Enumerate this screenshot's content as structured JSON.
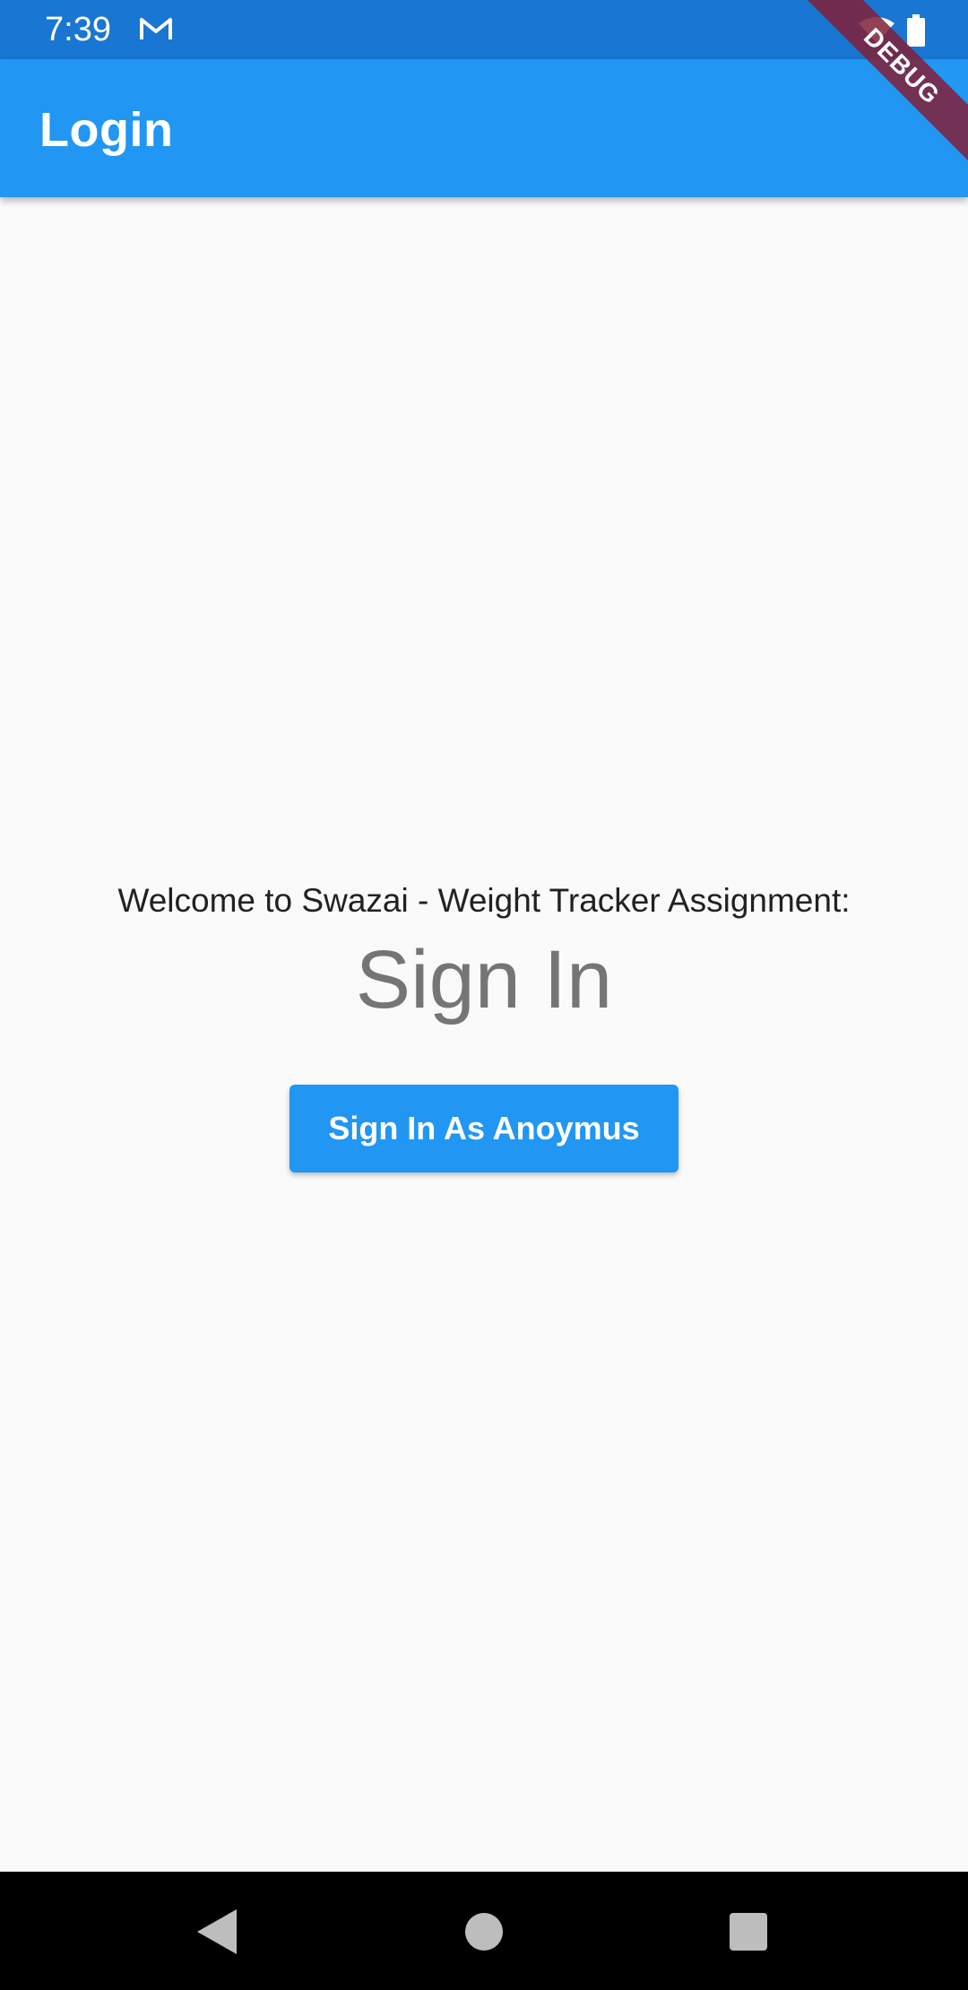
{
  "status_bar": {
    "time": "7:39",
    "notification_icon": "gmail-icon",
    "indicators": [
      "wifi-icon",
      "battery-icon"
    ]
  },
  "app_bar": {
    "title": "Login"
  },
  "debug_banner": {
    "label": "DEBUG"
  },
  "main": {
    "welcome_text": "Welcome to Swazai - Weight Tracker Assignment:",
    "heading": "Sign In",
    "anon_button_label": "Sign In As Anoymus"
  },
  "nav_bar": {
    "buttons": [
      "back-icon",
      "home-icon",
      "recents-icon"
    ]
  },
  "colors": {
    "status_bar": "#1976d2",
    "app_bar": "#2196f3",
    "button": "#2196f3",
    "background": "#fafafa",
    "heading_text": "#757575",
    "body_text": "#212121",
    "debug_banner": "#802038"
  }
}
